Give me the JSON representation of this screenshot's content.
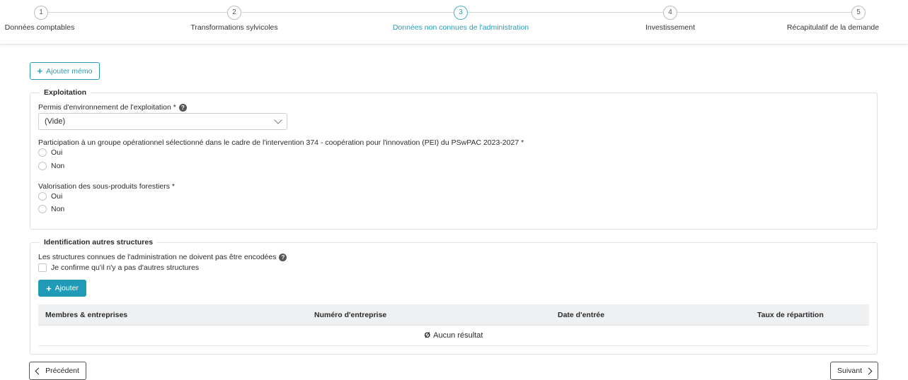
{
  "stepper": {
    "steps": [
      {
        "number": "1",
        "label": "Données comptables"
      },
      {
        "number": "2",
        "label": "Transformations sylvicoles"
      },
      {
        "number": "3",
        "label": "Données non connues de l'administration"
      },
      {
        "number": "4",
        "label": "Investissement"
      },
      {
        "number": "5",
        "label": "Récapitulatif de la demande"
      }
    ],
    "active_step": 3
  },
  "toolbar": {
    "add_memo_label": "Ajouter mémo"
  },
  "exploitation": {
    "legend": "Exploitation",
    "permis": {
      "label": "Permis d'environnement de l'exploitation *",
      "value": "(Vide)"
    },
    "participation": {
      "label": "Participation à un groupe opérationnel sélectionné dans le cadre de l'intervention 374 - coopération pour l'innovation (PEI) du PSwPAC 2023-2027 *",
      "options": [
        "Oui",
        "Non"
      ]
    },
    "valorisation": {
      "label": "Valorisation des sous-produits forestiers *",
      "options": [
        "Oui",
        "Non"
      ]
    }
  },
  "identification": {
    "legend": "Identification autres structures",
    "info": "Les structures connues de l'administration ne doivent pas être encodées",
    "confirm_label": "Je confirme qu'il n'y a pas d'autres structures",
    "add_label": "Ajouter",
    "table": {
      "columns": [
        "Membres & entreprises",
        "Numéro d'entreprise",
        "Date d'entrée",
        "Taux de répartition"
      ],
      "empty_symbol": "Ø",
      "empty_text": "Aucun résultat"
    }
  },
  "navigation": {
    "previous_label": "Précédent",
    "next_label": "Suivant"
  },
  "colors": {
    "accent": "#1f9bb8",
    "border": "#e1e1e1",
    "table_header": "#eef0f2"
  }
}
